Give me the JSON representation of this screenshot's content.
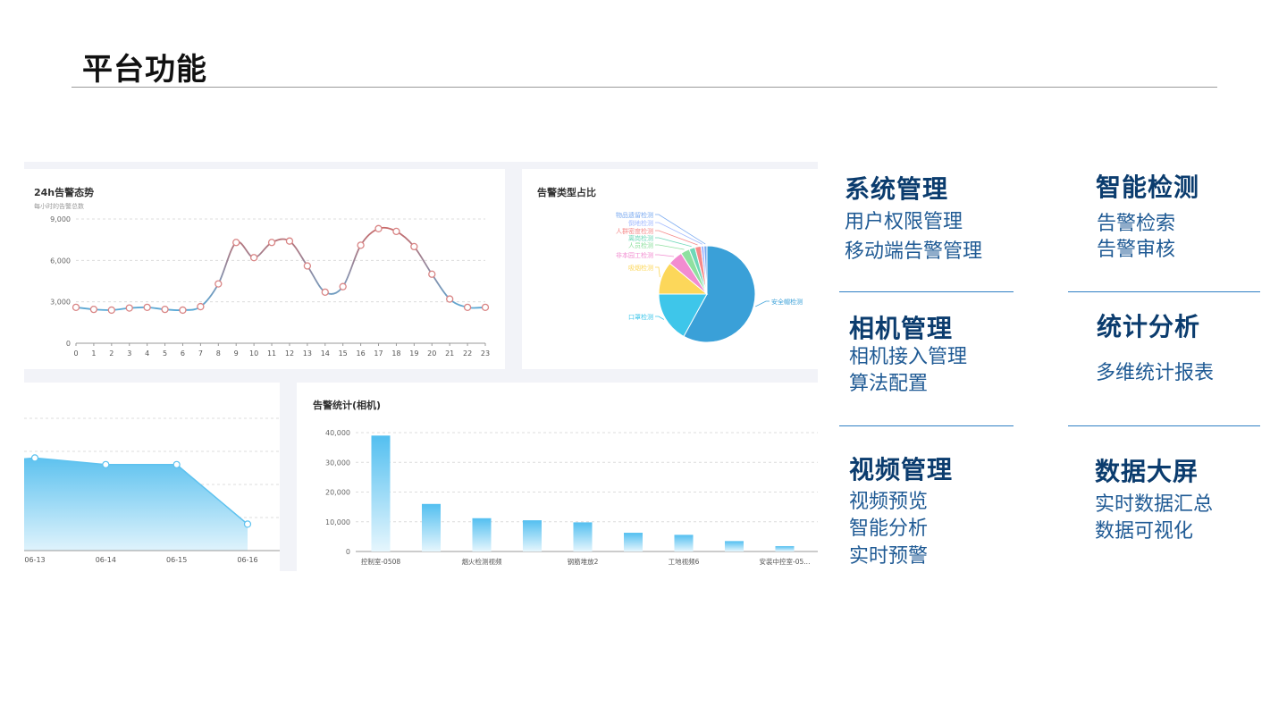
{
  "page": {
    "title": "平台功能"
  },
  "line_panel": {
    "title": "24h告警态势",
    "subtitle": "每小时的告警总数"
  },
  "pie_panel": {
    "title": "告警类型占比"
  },
  "bar_panel": {
    "title": "告警统计(相机)"
  },
  "chart_data": [
    {
      "type": "line",
      "title": "24h告警态势",
      "subtitle": "每小时的告警总数",
      "x": [
        0,
        1,
        2,
        3,
        4,
        5,
        6,
        7,
        8,
        9,
        10,
        11,
        12,
        13,
        14,
        15,
        16,
        17,
        18,
        19,
        20,
        21,
        22,
        23
      ],
      "series": [
        {
          "values": [
            2600,
            2450,
            2400,
            2550,
            2600,
            2450,
            2400,
            2650,
            4300,
            7300,
            6200,
            7300,
            7400,
            5600,
            3700,
            4100,
            7100,
            8300,
            8100,
            7000,
            5000,
            3200,
            2600,
            2600
          ]
        }
      ],
      "ylim": [
        0,
        9000
      ],
      "yticks": [
        0,
        3000,
        6000,
        9000
      ],
      "ytick_labels": [
        "0",
        "3,000",
        "6,000",
        "9,000"
      ],
      "grid": true,
      "colors": {
        "line_start": "#5aa9d6",
        "line_end": "#c86a6a",
        "marker_fill": "#ffffff",
        "marker_stroke": "#d98585"
      }
    },
    {
      "type": "pie",
      "title": "告警类型占比",
      "slices": [
        {
          "label": "安全帽检测",
          "value": 58,
          "color": "#3aa0d8"
        },
        {
          "label": "口罩检测",
          "value": 17,
          "color": "#3ec6ea"
        },
        {
          "label": "吸烟检测",
          "value": 11,
          "color": "#fcd75a"
        },
        {
          "label": "非本园工检测",
          "value": 5,
          "color": "#f28cd0"
        },
        {
          "label": "人员检测",
          "value": 3,
          "color": "#8fe0a0"
        },
        {
          "label": "离岗检测",
          "value": 2,
          "color": "#6fd8b8"
        },
        {
          "label": "人群密度检测",
          "value": 2,
          "color": "#f58a8a"
        },
        {
          "label": "倒地检测",
          "value": 1,
          "color": "#a0b8ff"
        },
        {
          "label": "物品遗留检测",
          "value": 1,
          "color": "#7aaaf0"
        }
      ],
      "legend": "labels on slices"
    },
    {
      "type": "area",
      "x": [
        "06-13",
        "06-14",
        "06-15",
        "06-16"
      ],
      "series": [
        {
          "values": [
            0.7,
            0.65,
            0.65,
            0.2
          ]
        }
      ],
      "grid": true,
      "colors": {
        "fill_top": "#5ec2ef",
        "fill_bottom": "#dff3fc",
        "line": "#5ec2ef"
      }
    },
    {
      "type": "bar",
      "title": "告警统计(相机)",
      "categories": [
        "控制室-0508",
        "",
        "烟火检测视频",
        "",
        "钢筋堆放2",
        "",
        "工地视频6",
        "",
        "安装中控室-05..."
      ],
      "values": [
        39000,
        16000,
        11200,
        10500,
        9800,
        6300,
        5600,
        3500,
        1800
      ],
      "ylim": [
        0,
        40000
      ],
      "yticks": [
        0,
        10000,
        20000,
        30000,
        40000
      ],
      "ytick_labels": [
        "0",
        "10,000",
        "20,000",
        "30,000",
        "40,000"
      ],
      "grid": true,
      "colors": {
        "bar_top": "#53bff0",
        "bar_bottom": "#e6f6fd"
      }
    }
  ],
  "features": {
    "system": {
      "title": "系统管理",
      "items": [
        "用户权限管理",
        "移动端告警管理"
      ]
    },
    "detect": {
      "title": "智能检测",
      "items": [
        "告警检索",
        "告警审核"
      ]
    },
    "camera": {
      "title": "相机管理",
      "items": [
        "相机接入管理",
        "算法配置"
      ]
    },
    "stats": {
      "title": "统计分析",
      "items": [
        "多维统计报表"
      ]
    },
    "video": {
      "title": "视频管理",
      "items": [
        "视频预览",
        "智能分析",
        "实时预警"
      ]
    },
    "screen": {
      "title": "数据大屏",
      "items": [
        "实时数据汇总",
        "数据可视化"
      ]
    }
  },
  "colors": {
    "feature_title": "#0b3c6e",
    "feature_item": "#1f5a94",
    "divider": "#2f7fc4"
  }
}
